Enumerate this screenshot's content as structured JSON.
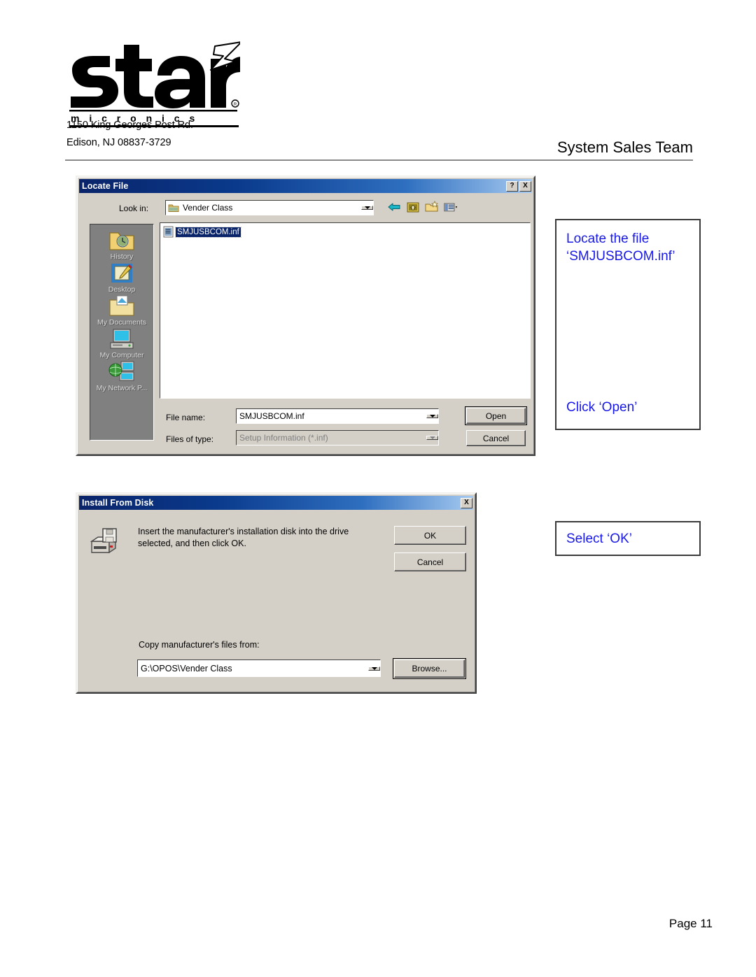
{
  "header": {
    "logo_alt": "star micronics",
    "logo_wordmark": "star",
    "logo_subtext": "m i c r o n i c s",
    "address_line1": "1150 King Georges Post Rd.",
    "address_line2": "Edison, NJ 08837-3729",
    "title": "System Sales Team"
  },
  "locate_file_dialog": {
    "title": "Locate File",
    "help_button": "?",
    "close_button": "X",
    "look_in_label": "Look in:",
    "look_in_value": "Vender Class",
    "toolbar": {
      "back": "back-icon",
      "up_one_level": "up-one-level-icon",
      "new_folder": "new-folder-icon",
      "views": "views-icon"
    },
    "places": [
      {
        "label": "History",
        "icon": "history-folder-icon"
      },
      {
        "label": "Desktop",
        "icon": "desktop-icon"
      },
      {
        "label": "My Documents",
        "icon": "my-documents-icon"
      },
      {
        "label": "My Computer",
        "icon": "my-computer-icon"
      },
      {
        "label": "My Network P...",
        "icon": "my-network-places-icon"
      }
    ],
    "files": [
      {
        "name": "SMJUSBCOM.inf",
        "icon": "inf-file-icon",
        "selected": true
      }
    ],
    "file_name_label": "File name:",
    "file_name_value": "SMJUSBCOM.inf",
    "files_of_type_label": "Files of type:",
    "files_of_type_value": "Setup Information (*.inf)",
    "open_button": "Open",
    "cancel_button": "Cancel"
  },
  "install_from_disk_dialog": {
    "title": "Install From Disk",
    "close_button": "X",
    "drive_icon": "floppy-drive-icon",
    "message": "Insert the manufacturer's installation disk into the drive selected, and then click OK.",
    "ok_button": "OK",
    "cancel_button": "Cancel",
    "copy_from_label": "Copy manufacturer's files from:",
    "copy_from_value": "G:\\OPOS\\Vender Class",
    "browse_button": "Browse..."
  },
  "callouts": {
    "locate_file_top": "Locate the file\n‘SMJUSBCOM.inf’",
    "locate_file_bottom": "Click ‘Open’",
    "install_disk": "Select ‘OK’"
  },
  "footer": {
    "page": "Page 11"
  },
  "colors": {
    "callout_text": "#1818e8",
    "dialog_face": "#d4d0c8",
    "titlebar_start": "#0a246a",
    "titlebar_end": "#a6caf0",
    "selection": "#0a246a"
  }
}
